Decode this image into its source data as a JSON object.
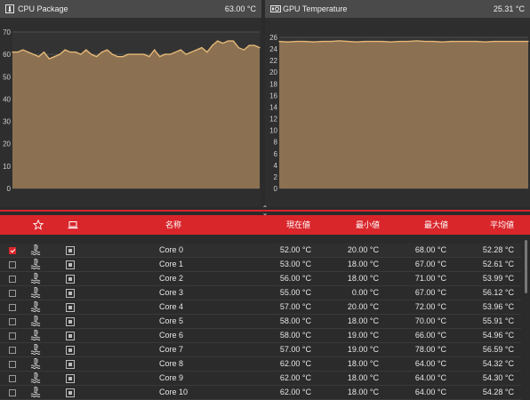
{
  "panels": [
    {
      "title": "CPU Package",
      "value": "63.00 °C"
    },
    {
      "title": "GPU Temperature",
      "value": "25.31 °C"
    }
  ],
  "chart_data": [
    {
      "type": "area",
      "y_ticks": [
        "0",
        "10",
        "20",
        "30",
        "40",
        "50",
        "60",
        "70"
      ],
      "ylim": [
        0,
        70
      ],
      "grid": true,
      "line_color": "#e6b878",
      "fill_color": "#8b7152",
      "values": [
        61,
        61,
        62,
        61,
        60,
        59,
        61,
        58,
        59,
        60,
        62,
        61,
        61,
        60,
        62,
        60,
        59,
        61,
        62,
        60,
        59,
        59,
        60,
        60,
        60,
        60,
        59,
        62,
        59,
        60,
        60,
        61,
        62,
        60,
        61,
        62,
        63,
        61,
        64,
        66,
        65,
        66,
        66,
        63,
        62,
        64,
        64,
        63
      ]
    },
    {
      "type": "area",
      "y_ticks": [
        "0",
        "2",
        "4",
        "6",
        "8",
        "10",
        "12",
        "14",
        "16",
        "18",
        "20",
        "22",
        "24",
        "26"
      ],
      "ylim": [
        0,
        26
      ],
      "grid": true,
      "line_color": "#e6b878",
      "fill_color": "#8b7152",
      "values": [
        25.3,
        25.2,
        25.3,
        25.3,
        25.2,
        25.3,
        25.3,
        25.4,
        25.3,
        25.2,
        25.3,
        25.3,
        25.3,
        25.2,
        25.3,
        25.3,
        25.4,
        25.3,
        25.3,
        25.2,
        25.3,
        25.3,
        25.3,
        25.3,
        25.2,
        25.3,
        25.3,
        25.3,
        25.3,
        25.3
      ]
    }
  ],
  "table": {
    "columns": {
      "name": "名称",
      "current": "現在値",
      "min": "最小値",
      "max": "最大値",
      "avg": "平均値"
    },
    "rows": [
      {
        "checked": true,
        "name": "Core 0",
        "current": "52.00 °C",
        "min": "20.00 °C",
        "max": "68.00 °C",
        "avg": "52.28 °C"
      },
      {
        "checked": false,
        "name": "Core 1",
        "current": "53.00 °C",
        "min": "18.00 °C",
        "max": "67.00 °C",
        "avg": "52.61 °C"
      },
      {
        "checked": false,
        "name": "Core 2",
        "current": "56.00 °C",
        "min": "18.00 °C",
        "max": "71.00 °C",
        "avg": "53.99 °C"
      },
      {
        "checked": false,
        "name": "Core 3",
        "current": "55.00 °C",
        "min": "0.00 °C",
        "max": "67.00 °C",
        "avg": "56.12 °C"
      },
      {
        "checked": false,
        "name": "Core 4",
        "current": "57.00 °C",
        "min": "20.00 °C",
        "max": "72.00 °C",
        "avg": "53.96 °C"
      },
      {
        "checked": false,
        "name": "Core 5",
        "current": "58.00 °C",
        "min": "18.00 °C",
        "max": "70.00 °C",
        "avg": "55.91 °C"
      },
      {
        "checked": false,
        "name": "Core 6",
        "current": "58.00 °C",
        "min": "19.00 °C",
        "max": "66.00 °C",
        "avg": "54.96 °C"
      },
      {
        "checked": false,
        "name": "Core 7",
        "current": "57.00 °C",
        "min": "19.00 °C",
        "max": "78.00 °C",
        "avg": "56.59 °C"
      },
      {
        "checked": false,
        "name": "Core 8",
        "current": "62.00 °C",
        "min": "18.00 °C",
        "max": "64.00 °C",
        "avg": "54.32 °C"
      },
      {
        "checked": false,
        "name": "Core 9",
        "current": "62.00 °C",
        "min": "18.00 °C",
        "max": "64.00 °C",
        "avg": "54.30 °C"
      },
      {
        "checked": false,
        "name": "Core 10",
        "current": "62.00 °C",
        "min": "18.00 °C",
        "max": "64.00 °C",
        "avg": "54.28 °C"
      }
    ]
  },
  "icons": {
    "panel_cpu": "thermometer-icon",
    "panel_gpu": "gpu-card-icon",
    "header_favorite": "star-icon",
    "header_device": "laptop-icon",
    "row_sensor": "temperature-sensor-icon",
    "row_device": "cpu-chip-icon"
  },
  "colors": {
    "accent": "#d9262b",
    "chart_fill": "#8b7152",
    "chart_line": "#e6b878"
  }
}
